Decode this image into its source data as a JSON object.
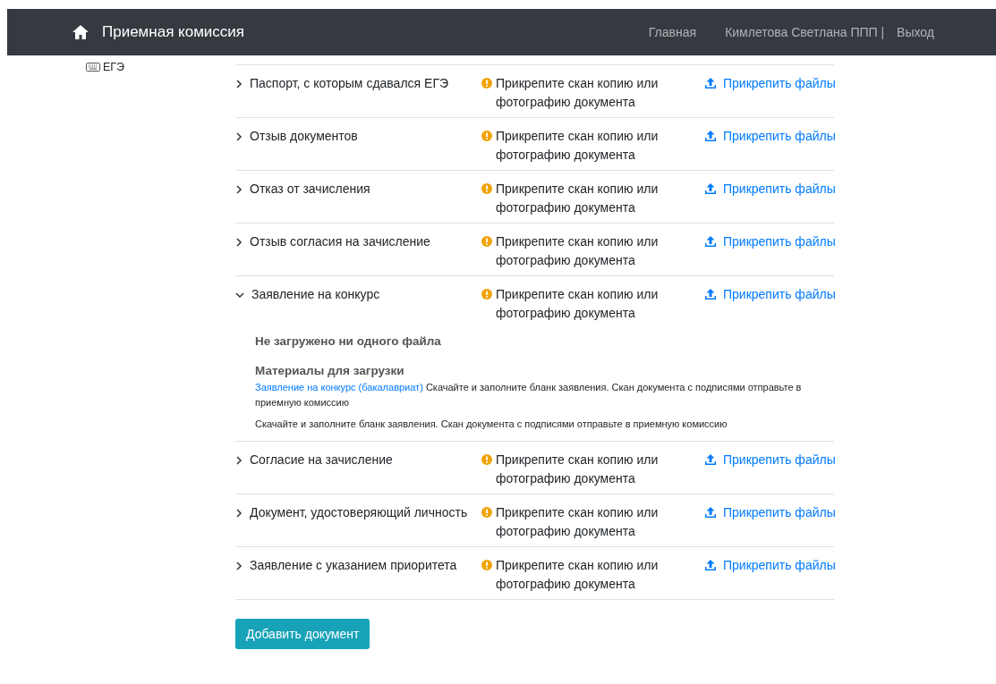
{
  "navbar": {
    "brand": "Приемная комиссия",
    "links": [
      {
        "label": "Главная",
        "kind": "link"
      },
      {
        "label": "Кимлетова Светлана ППП |",
        "kind": "user"
      },
      {
        "label": "Выход",
        "kind": "link"
      }
    ]
  },
  "sidebar": {
    "items": [
      {
        "label": "ЕГЭ"
      }
    ]
  },
  "documents": [
    {
      "name": "Паспорт, с которым сдавался ЕГЭ",
      "expanded": false,
      "status": "Прикрепите скан копию или фотографию документа",
      "action": "Прикрепить файлы"
    },
    {
      "name": "Отзыв документов",
      "expanded": false,
      "status": "Прикрепите скан копию или фотографию документа",
      "action": "Прикрепить файлы"
    },
    {
      "name": "Отказ от зачисления",
      "expanded": false,
      "status": "Прикрепите скан копию или фотографию документа",
      "action": "Прикрепить файлы"
    },
    {
      "name": "Отзыв согласия на зачисление",
      "expanded": false,
      "status": "Прикрепите скан копию или фотографию документа",
      "action": "Прикрепить файлы"
    },
    {
      "name": "Заявление на конкурс",
      "expanded": true,
      "status": "Прикрепите скан копию или фотографию документа",
      "action": "Прикрепить файлы",
      "details": {
        "empty_message": "Не загружено ни одного файла",
        "materials_title": "Материалы для загрузки",
        "materials": [
          {
            "link": "Заявление на конкурс (бакалавриат)",
            "text": "Скачайте и заполните бланк заявления. Скан документа с подписями отправьте в приемную комиссию"
          }
        ],
        "note": "Скачайте и заполните бланк заявления. Скан документа с подписями отправьте в приемную комиссию"
      }
    },
    {
      "name": "Согласие на зачисление",
      "expanded": false,
      "status": "Прикрепите скан копию или фотографию документа",
      "action": "Прикрепить файлы"
    },
    {
      "name": "Документ, удостоверяющий личность",
      "expanded": false,
      "status": "Прикрепите скан копию или фотографию документа",
      "action": "Прикрепить файлы"
    },
    {
      "name": "Заявление с указанием приоритета",
      "expanded": false,
      "status": "Прикрепите скан копию или фотографию документа",
      "action": "Прикрепить файлы"
    }
  ],
  "add_button": "Добавить документ"
}
